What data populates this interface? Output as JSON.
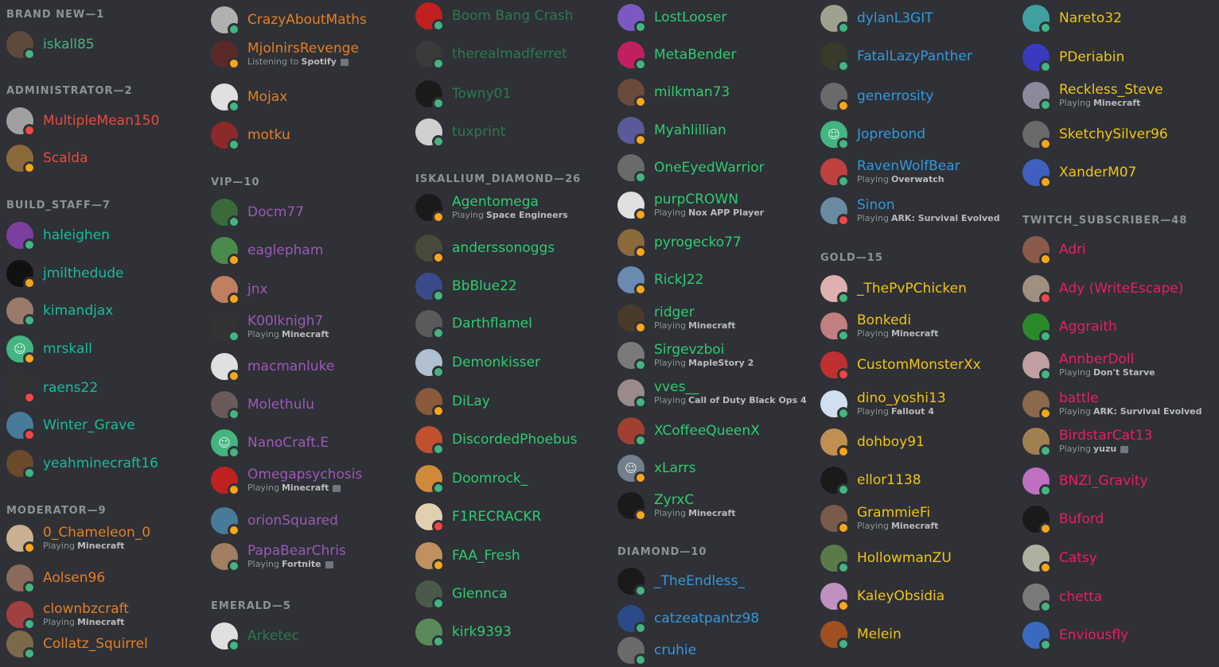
{
  "columns": [
    {
      "sections": [
        {
          "header": "BRAND NEW—1",
          "members": [
            {
              "name": "iskall85",
              "color": "#43b581",
              "status": "online",
              "avatar": "#5d4a3a"
            }
          ]
        },
        {
          "header": "ADMINISTRATOR—2",
          "members": [
            {
              "name": "MultipleMean150",
              "color": "#e74c3c",
              "status": "dnd",
              "avatar": "#a0a0a0"
            },
            {
              "name": "Scalda",
              "color": "#e74c3c",
              "status": "idle",
              "avatar": "#8a6a3a"
            }
          ]
        },
        {
          "header": "BUILD_STAFF—7",
          "members": [
            {
              "name": "haleighen",
              "color": "#1abc9c",
              "status": "online",
              "avatar": "#7b3fa0"
            },
            {
              "name": "jmilthedude",
              "color": "#1abc9c",
              "status": "idle",
              "avatar": "#111111"
            },
            {
              "name": "kimandjax",
              "color": "#1abc9c",
              "status": "online",
              "avatar": "#9a7a6a"
            },
            {
              "name": "mrskall",
              "color": "#1abc9c",
              "status": "idle",
              "avatar": "#43b581",
              "glyph": "☺"
            },
            {
              "name": "raens22",
              "color": "#1abc9c",
              "status": "dnd",
              "avatar": "#333333"
            },
            {
              "name": "Winter_Grave",
              "color": "#1abc9c",
              "status": "dnd",
              "avatar": "#4a7a9a"
            },
            {
              "name": "yeahminecraft16",
              "color": "#1abc9c",
              "status": "online",
              "avatar": "#6a4a2a"
            }
          ]
        },
        {
          "header": "MODERATOR—9",
          "members": [
            {
              "name": "0_Chameleon_0",
              "color": "#e67e22",
              "status": "idle",
              "avatar": "#c8b090",
              "activity": "Playing",
              "game": "Minecraft"
            },
            {
              "name": "Aolsen96",
              "color": "#e67e22",
              "status": "online",
              "avatar": "#8a6a5a"
            },
            {
              "name": "clownbzcraft",
              "color": "#e67e22",
              "status": "online",
              "avatar": "#a04040",
              "activity": "Playing",
              "game": "Minecraft"
            },
            {
              "name": "Collatz_Squirrel",
              "color": "#e67e22",
              "status": "online",
              "avatar": "#7a6a4a"
            }
          ]
        }
      ]
    },
    {
      "sections": [
        {
          "header": "",
          "members": [
            {
              "name": "CrazyAboutMaths",
              "color": "#e67e22",
              "status": "online",
              "avatar": "#b0b0b0"
            },
            {
              "name": "MjolnirsRevenge",
              "color": "#e67e22",
              "status": "idle",
              "avatar": "#5a2a2a",
              "activity": "Listening to",
              "game": "Spotify",
              "rich": true
            },
            {
              "name": "Mojax",
              "color": "#e67e22",
              "status": "online",
              "avatar": "#e0e0e0"
            },
            {
              "name": "motku",
              "color": "#e67e22",
              "status": "online",
              "avatar": "#8a2a2a"
            }
          ]
        },
        {
          "header": "VIP—10",
          "members": [
            {
              "name": "Docm77",
              "color": "#9b59b6",
              "status": "online",
              "avatar": "#3a6a3a"
            },
            {
              "name": "eaglepham",
              "color": "#9b59b6",
              "status": "idle",
              "avatar": "#4a8a4a"
            },
            {
              "name": "jnx",
              "color": "#9b59b6",
              "status": "idle",
              "avatar": "#c08060"
            },
            {
              "name": "K00lknigh7",
              "color": "#9b59b6",
              "status": "online",
              "avatar": "#333333",
              "activity": "Playing",
              "game": "Minecraft"
            },
            {
              "name": "macmanluke",
              "color": "#9b59b6",
              "status": "idle",
              "avatar": "#e0e0e0"
            },
            {
              "name": "Molethulu",
              "color": "#9b59b6",
              "status": "online",
              "avatar": "#6a5a5a"
            },
            {
              "name": "NanoCraft.E",
              "color": "#9b59b6",
              "status": "online",
              "avatar": "#43b581",
              "glyph": "☺"
            },
            {
              "name": "Omegapsychosis",
              "color": "#9b59b6",
              "status": "idle",
              "avatar": "#c02020",
              "activity": "Playing",
              "game": "Minecraft",
              "rich": true
            },
            {
              "name": "orionSquared",
              "color": "#9b59b6",
              "status": "idle",
              "avatar": "#4a7a9a"
            },
            {
              "name": "PapaBearChris",
              "color": "#9b59b6",
              "status": "online",
              "avatar": "#a08060",
              "activity": "Playing",
              "game": "Fortnite",
              "rich": true
            }
          ]
        },
        {
          "header": "EMERALD—5",
          "members": [
            {
              "name": "Arketec",
              "color": "#2ecc71",
              "status": "online",
              "avatar": "#e0e0e0",
              "offline": true
            }
          ]
        }
      ]
    },
    {
      "sections": [
        {
          "header": "",
          "members": [
            {
              "name": "Boom Bang Crash",
              "color": "#2ecc71",
              "status": "online",
              "avatar": "#c02020",
              "offline": true
            },
            {
              "name": "therealmadferret",
              "color": "#2ecc71",
              "status": "online",
              "avatar": "#3a3a3a",
              "offline": true
            },
            {
              "name": "Towny01",
              "color": "#2ecc71",
              "status": "online",
              "avatar": "#1a1a1a",
              "offline": true
            },
            {
              "name": "tuxprint",
              "color": "#2ecc71",
              "status": "online",
              "avatar": "#d0d0d0",
              "offline": true
            }
          ]
        },
        {
          "header": "ISKALLIUM_DIAMOND—26",
          "members": [
            {
              "name": "Agentomega",
              "color": "#2ecc71",
              "status": "idle",
              "avatar": "#1a1a1a",
              "activity": "Playing",
              "game": "Space Engineers"
            },
            {
              "name": "anderssonoggs",
              "color": "#2ecc71",
              "status": "idle",
              "avatar": "#4a4a3a"
            },
            {
              "name": "BbBlue22",
              "color": "#2ecc71",
              "status": "online",
              "avatar": "#3a4a8a"
            },
            {
              "name": "Darthflamel",
              "color": "#2ecc71",
              "status": "online",
              "avatar": "#5a5a5a"
            },
            {
              "name": "Demonkisser",
              "color": "#2ecc71",
              "status": "online",
              "avatar": "#b0c0d0"
            },
            {
              "name": "DiLay",
              "color": "#2ecc71",
              "status": "idle",
              "avatar": "#8a5a3a"
            },
            {
              "name": "DiscordedPhoebus",
              "color": "#2ecc71",
              "status": "online",
              "avatar": "#c05030"
            },
            {
              "name": "Doomrock_",
              "color": "#2ecc71",
              "status": "online",
              "avatar": "#d08a3a"
            },
            {
              "name": "F1RECRACKR",
              "color": "#2ecc71",
              "status": "dnd",
              "avatar": "#e0d0b0"
            },
            {
              "name": "FAA_Fresh",
              "color": "#2ecc71",
              "status": "idle",
              "avatar": "#c09060"
            },
            {
              "name": "Glennca",
              "color": "#2ecc71",
              "status": "online",
              "avatar": "#4a5a4a"
            },
            {
              "name": "kirk9393",
              "color": "#2ecc71",
              "status": "online",
              "avatar": "#5a8a5a"
            }
          ]
        }
      ]
    },
    {
      "sections": [
        {
          "header": "",
          "members": [
            {
              "name": "LostLooser",
              "color": "#2ecc71",
              "status": "online",
              "avatar": "#7a5ac0"
            },
            {
              "name": "MetaBender",
              "color": "#2ecc71",
              "status": "online",
              "avatar": "#c02060"
            },
            {
              "name": "milkman73",
              "color": "#2ecc71",
              "status": "idle",
              "avatar": "#6a4a3a"
            },
            {
              "name": "Myahlillian",
              "color": "#2ecc71",
              "status": "idle",
              "avatar": "#5a5a9a"
            },
            {
              "name": "OneEyedWarrior",
              "color": "#2ecc71",
              "status": "online",
              "avatar": "#6a6a6a"
            },
            {
              "name": "purpCROWN",
              "color": "#2ecc71",
              "status": "idle",
              "avatar": "#e0e0e0",
              "activity": "Playing",
              "game": "Nox APP Player"
            },
            {
              "name": "pyrogecko77",
              "color": "#2ecc71",
              "status": "idle",
              "avatar": "#8a6a3a"
            },
            {
              "name": "RickJ22",
              "color": "#2ecc71",
              "status": "idle",
              "avatar": "#6a8ab0"
            },
            {
              "name": "ridger",
              "color": "#2ecc71",
              "status": "idle",
              "avatar": "#4a3a2a",
              "activity": "Playing",
              "game": "Minecraft"
            },
            {
              "name": "Sirgevzboi",
              "color": "#2ecc71",
              "status": "online",
              "avatar": "#7a7a7a",
              "activity": "Playing",
              "game": "MapleStory 2"
            },
            {
              "name": "vves__",
              "color": "#2ecc71",
              "status": "online",
              "avatar": "#9a8a8a",
              "activity": "Playing",
              "game": "Call of Duty Black Ops 4"
            },
            {
              "name": "XCoffeeQueenX",
              "color": "#2ecc71",
              "status": "online",
              "avatar": "#a04030"
            },
            {
              "name": "xLarrs",
              "color": "#2ecc71",
              "status": "idle",
              "avatar": "#747f8d",
              "glyph": "☺"
            },
            {
              "name": "ZyrxC",
              "color": "#2ecc71",
              "status": "idle",
              "avatar": "#1a1a1a",
              "activity": "Playing",
              "game": "Minecraft"
            }
          ]
        },
        {
          "header": "DIAMOND—10",
          "members": [
            {
              "name": "_TheEndless_",
              "color": "#3498db",
              "status": "online",
              "avatar": "#1a1a1a"
            },
            {
              "name": "catzeatpantz98",
              "color": "#3498db",
              "status": "online",
              "avatar": "#2a4a8a"
            },
            {
              "name": "cruhie",
              "color": "#3498db",
              "status": "online",
              "avatar": "#6a6a6a"
            }
          ]
        }
      ]
    },
    {
      "sections": [
        {
          "header": "",
          "members": [
            {
              "name": "dylanL3GIT",
              "color": "#3498db",
              "status": "online",
              "avatar": "#a0a090"
            },
            {
              "name": "FatalLazyPanther",
              "color": "#3498db",
              "status": "online",
              "avatar": "#3a3a2a"
            },
            {
              "name": "generrosity",
              "color": "#3498db",
              "status": "idle",
              "avatar": "#6a6a6a"
            },
            {
              "name": "Joprebond",
              "color": "#3498db",
              "status": "online",
              "avatar": "#43b581",
              "glyph": "☺"
            },
            {
              "name": "RavenWolfBear",
              "color": "#3498db",
              "status": "online",
              "avatar": "#c04040",
              "activity": "Playing",
              "game": "Overwatch"
            },
            {
              "name": "Sinon",
              "color": "#3498db",
              "status": "dnd",
              "avatar": "#6a8aa0",
              "activity": "Playing",
              "game": "ARK: Survival Evolved"
            }
          ]
        },
        {
          "header": "GOLD—15",
          "members": [
            {
              "name": "_ThePvPChicken",
              "color": "#f1c40f",
              "status": "online",
              "avatar": "#e0b0b0"
            },
            {
              "name": "Bonkedi",
              "color": "#f1c40f",
              "status": "online",
              "avatar": "#c08080",
              "activity": "Playing",
              "game": "Minecraft"
            },
            {
              "name": "CustomMonsterXx",
              "color": "#f1c40f",
              "status": "dnd",
              "avatar": "#c03030"
            },
            {
              "name": "dino_yoshi13",
              "color": "#f1c40f",
              "status": "online",
              "avatar": "#d0e0f0",
              "activity": "Playing",
              "game": "Fallout 4"
            },
            {
              "name": "dohboy91",
              "color": "#f1c40f",
              "status": "idle",
              "avatar": "#c09050"
            },
            {
              "name": "ellor1138",
              "color": "#f1c40f",
              "status": "online",
              "avatar": "#1a1a1a"
            },
            {
              "name": "GrammieFi",
              "color": "#f1c40f",
              "status": "idle",
              "avatar": "#7a5a4a",
              "activity": "Playing",
              "game": "Minecraft"
            },
            {
              "name": "HollowmanZU",
              "color": "#f1c40f",
              "status": "online",
              "avatar": "#5a7a4a"
            },
            {
              "name": "KaleyObsidia",
              "color": "#f1c40f",
              "status": "idle",
              "avatar": "#c090c0"
            },
            {
              "name": "Melein",
              "color": "#f1c40f",
              "status": "online",
              "avatar": "#a05020"
            }
          ]
        }
      ]
    },
    {
      "sections": [
        {
          "header": "",
          "members": [
            {
              "name": "Nareto32",
              "color": "#f1c40f",
              "status": "online",
              "avatar": "#40a0a0"
            },
            {
              "name": "PDeriabin",
              "color": "#f1c40f",
              "status": "online",
              "avatar": "#3a3ac0"
            },
            {
              "name": "Reckless_Steve",
              "color": "#f1c40f",
              "status": "online",
              "avatar": "#8a8a9a",
              "activity": "Playing",
              "game": "Minecraft"
            },
            {
              "name": "SketchySilver96",
              "color": "#f1c40f",
              "status": "idle",
              "avatar": "#6a6a6a"
            },
            {
              "name": "XanderM07",
              "color": "#f1c40f",
              "status": "idle",
              "avatar": "#4060c0"
            }
          ]
        },
        {
          "header": "TWITCH_SUBSCRIBER—48",
          "members": [
            {
              "name": "Adri",
              "color": "#e91e63",
              "status": "idle",
              "avatar": "#8a5a4a"
            },
            {
              "name": "Ady (WriteEscape)",
              "color": "#e91e63",
              "status": "dnd",
              "avatar": "#a09080"
            },
            {
              "name": "Aggraith",
              "color": "#e91e63",
              "status": "online",
              "avatar": "#2a8a2a"
            },
            {
              "name": "AnnberDoll",
              "color": "#e91e63",
              "status": "online",
              "avatar": "#c0a0a0",
              "activity": "Playing",
              "game": "Don't Starve"
            },
            {
              "name": "battle",
              "color": "#e91e63",
              "status": "idle",
              "avatar": "#8a6a4a",
              "activity": "Playing",
              "game": "ARK: Survival Evolved"
            },
            {
              "name": "BirdstarCat13",
              "color": "#e91e63",
              "status": "online",
              "avatar": "#a08050",
              "activity": "Playing",
              "game": "yuzu",
              "rich": true
            },
            {
              "name": "BNZI_Gravity",
              "color": "#e91e63",
              "status": "online",
              "avatar": "#c070c0"
            },
            {
              "name": "Buford",
              "color": "#e91e63",
              "status": "idle",
              "avatar": "#1a1a1a"
            },
            {
              "name": "Catsy",
              "color": "#e91e63",
              "status": "idle",
              "avatar": "#b0b0a0"
            },
            {
              "name": "chetta",
              "color": "#e91e63",
              "status": "online",
              "avatar": "#7a7a7a"
            },
            {
              "name": "Enviousfly",
              "color": "#e91e63",
              "status": "online",
              "avatar": "#3a6ac0"
            }
          ]
        }
      ]
    }
  ]
}
